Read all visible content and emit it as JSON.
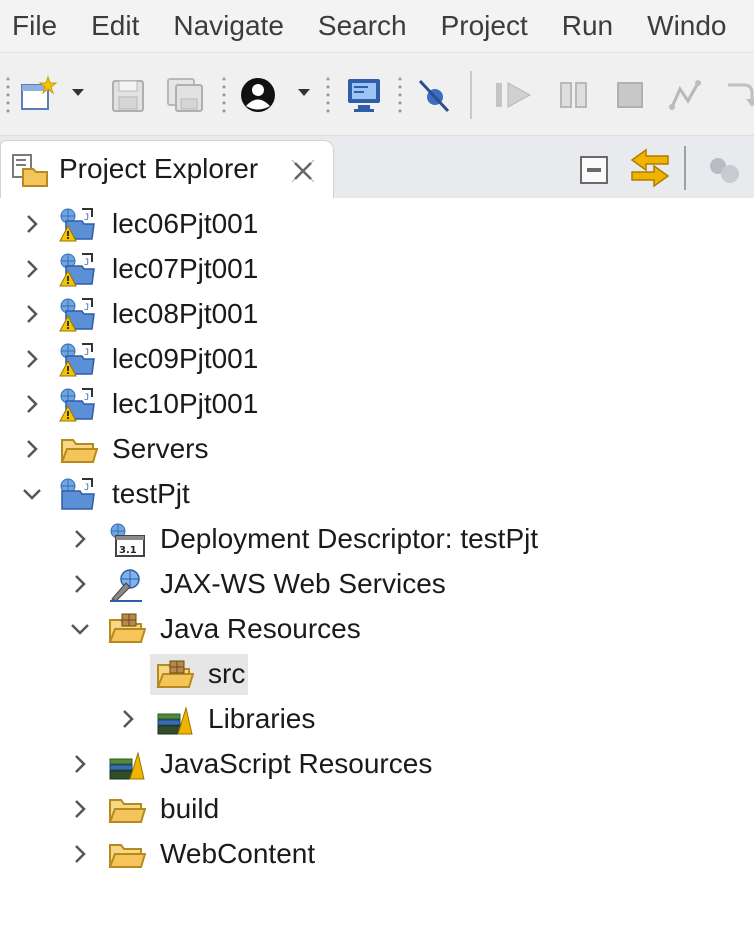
{
  "menu": [
    "File",
    "Edit",
    "Navigate",
    "Search",
    "Project",
    "Run",
    "Windo"
  ],
  "toolbar": {
    "icons": [
      "new-wizard-icon",
      "dropdown-arrow-icon",
      "save-icon",
      "save-all-icon",
      "user-profile-icon",
      "dropdown-arrow-icon",
      "monitor-icon",
      "skip-breakpoints-icon",
      "resume-icon",
      "suspend-icon",
      "terminate-icon",
      "disconnect-icon",
      "step-into-icon"
    ]
  },
  "view": {
    "title": "Project Explorer",
    "close_glyph": "⊠",
    "icons": [
      "collapse-all-icon",
      "link-with-editor-icon",
      "view-menu-icon"
    ]
  },
  "tree": {
    "items": [
      {
        "label": "lec06Pjt001",
        "icon": "web-project-warning-icon",
        "expanded": false
      },
      {
        "label": "lec07Pjt001",
        "icon": "web-project-warning-icon",
        "expanded": false
      },
      {
        "label": "lec08Pjt001",
        "icon": "web-project-warning-icon",
        "expanded": false
      },
      {
        "label": "lec09Pjt001",
        "icon": "web-project-warning-icon",
        "expanded": false
      },
      {
        "label": "lec10Pjt001",
        "icon": "web-project-warning-icon",
        "expanded": false
      },
      {
        "label": "Servers",
        "icon": "folder-icon",
        "expanded": false
      },
      {
        "label": "testPjt",
        "icon": "web-project-icon",
        "expanded": true
      },
      {
        "label": "Deployment Descriptor: testPjt",
        "icon": "deployment-descriptor-icon",
        "badge": "3.1",
        "expanded": false
      },
      {
        "label": "JAX-WS Web Services",
        "icon": "web-services-icon",
        "expanded": false
      },
      {
        "label": "Java Resources",
        "icon": "java-resources-icon",
        "expanded": true
      },
      {
        "label": "src",
        "icon": "source-folder-icon",
        "selected": true
      },
      {
        "label": "Libraries",
        "icon": "libraries-icon",
        "expanded": false
      },
      {
        "label": "JavaScript Resources",
        "icon": "libraries-icon",
        "expanded": false
      },
      {
        "label": "build",
        "icon": "folder-icon",
        "expanded": false
      },
      {
        "label": "WebContent",
        "icon": "folder-icon",
        "expanded": false
      }
    ]
  },
  "colors": {
    "folder": "#f3c55a",
    "project_blue": "#4a79c8",
    "warning": "#f0b400",
    "toolbar_bg": "#f0f0f0"
  }
}
